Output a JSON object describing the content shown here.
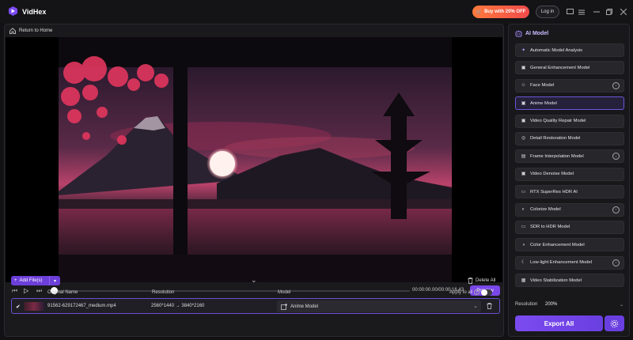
{
  "app": {
    "name": "VidHex"
  },
  "header": {
    "buy_label": "Buy with 20% OFF",
    "login_label": "Log in"
  },
  "nav": {
    "return_label": "Return to Home"
  },
  "player": {
    "timecode": "00:00:00.00/00:00:16.43",
    "preview_label": "Preview",
    "progress": 0
  },
  "toolbar": {
    "add_label": "Add File(s)",
    "delete_all_label": "Delete All"
  },
  "table": {
    "col_name": "Original Name",
    "col_resolution": "Resolution",
    "col_model": "Model",
    "apply_all_label": "Apply to all",
    "rows": [
      {
        "name": "91562-629172467_medium.mp4",
        "resolution": "2560*1440 → 3840*2160",
        "model": "Anime Model"
      }
    ]
  },
  "ai_panel": {
    "title": "AI Model",
    "models": [
      {
        "label": "Automatic Model Analysis",
        "icon": "sparkle-icon",
        "download": false,
        "active": false
      },
      {
        "label": "General Enhancement Model",
        "icon": "image-icon",
        "download": false,
        "active": false
      },
      {
        "label": "Face Model",
        "icon": "face-icon",
        "download": true,
        "active": false
      },
      {
        "label": "Anime Model",
        "icon": "anime-icon",
        "download": false,
        "active": true
      },
      {
        "label": "Video Quality Repair Model",
        "icon": "repair-icon",
        "download": false,
        "active": false
      },
      {
        "label": "Detail Restoration Model",
        "icon": "restore-icon",
        "download": false,
        "active": false
      },
      {
        "label": "Frame Interpolation Model",
        "icon": "frames-icon",
        "download": true,
        "active": false
      },
      {
        "label": "Video Denoise Model",
        "icon": "denoise-icon",
        "download": false,
        "active": false
      },
      {
        "label": "RTX SuperRes HDR AI",
        "icon": "rtx-icon",
        "download": false,
        "active": false
      },
      {
        "label": "Colorize Model",
        "icon": "palette-icon",
        "download": true,
        "active": false
      },
      {
        "label": "SDR to HDR Model",
        "icon": "hdr-icon",
        "download": false,
        "active": false
      },
      {
        "label": "Color Enhancement Model",
        "icon": "color-icon",
        "download": false,
        "active": false
      },
      {
        "label": "Low-light Enhancement Model",
        "icon": "moon-icon",
        "download": true,
        "active": false
      },
      {
        "label": "Video Stabilization Model",
        "icon": "stabilize-icon",
        "download": false,
        "active": false
      }
    ],
    "resolution_label": "Resolution",
    "resolution_value": "200%",
    "export_label": "Export All"
  }
}
